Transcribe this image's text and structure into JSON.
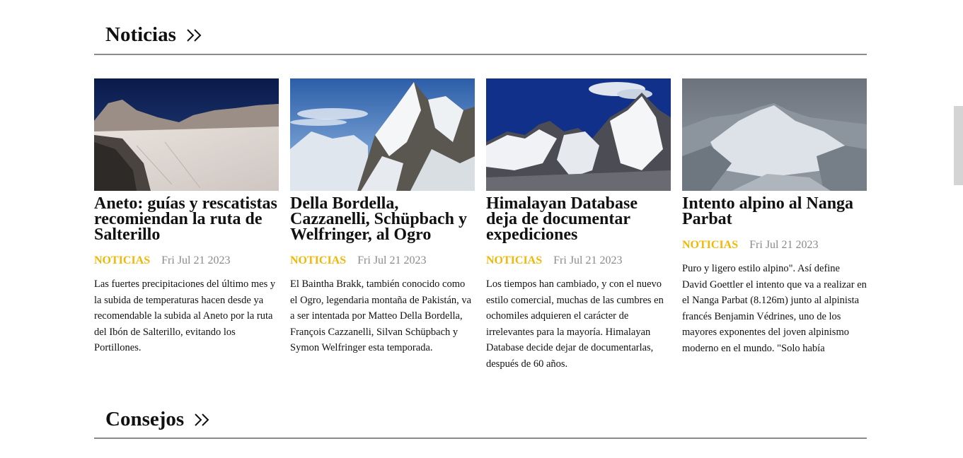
{
  "sections": {
    "noticias": {
      "title": "Noticias"
    },
    "consejos": {
      "title": "Consejos"
    }
  },
  "articles": [
    {
      "title": "Aneto: guías y rescatistas recomiendan la ruta de Salterillo",
      "category": "NOTICIAS",
      "date": "Fri Jul 21 2023",
      "excerpt": "Las fuertes precipitaciones del último mes y la subida de temperaturas hacen desde ya recomendable la subida al Aneto por la ruta del Ibón de Salterillo, evitando los Portillones."
    },
    {
      "title": "Della Bordella, Cazzanelli, Schüpbach y Welfringer, al Ogro",
      "category": "NOTICIAS",
      "date": "Fri Jul 21 2023",
      "excerpt": "El Baintha Brakk, también conocido como el Ogro, legendaria montaña de Pakistán, va a ser intentada por Matteo Della Bordella, François Cazzanelli, Silvan Schüpbach y Symon Welfringer esta temporada."
    },
    {
      "title": "Himalayan Database deja de documentar expediciones",
      "category": "NOTICIAS",
      "date": "Fri Jul 21 2023",
      "excerpt": "Los tiempos han cambiado, y con el nuevo estilo comercial, muchas de las cumbres en ochomiles adquieren el carácter de irrelevantes para la mayoría. Himalayan Database decide dejar de documentarlas, después de 60 años."
    },
    {
      "title": "Intento alpino al Nanga Parbat",
      "category": "NOTICIAS",
      "date": "Fri Jul 21 2023",
      "excerpt": "Puro y ligero estilo alpino\". Así define David Goettler el intento que va a realizar en el Nanga Parbat (8.126m) junto al alpinista francés Benjamin Védrines, uno de los mayores exponentes del joven alpinismo moderno en el mundo. \"Solo había"
    }
  ],
  "colors": {
    "accent": "#f2b705",
    "date": "#8a8a8a",
    "rule": "#8a8a8a"
  }
}
